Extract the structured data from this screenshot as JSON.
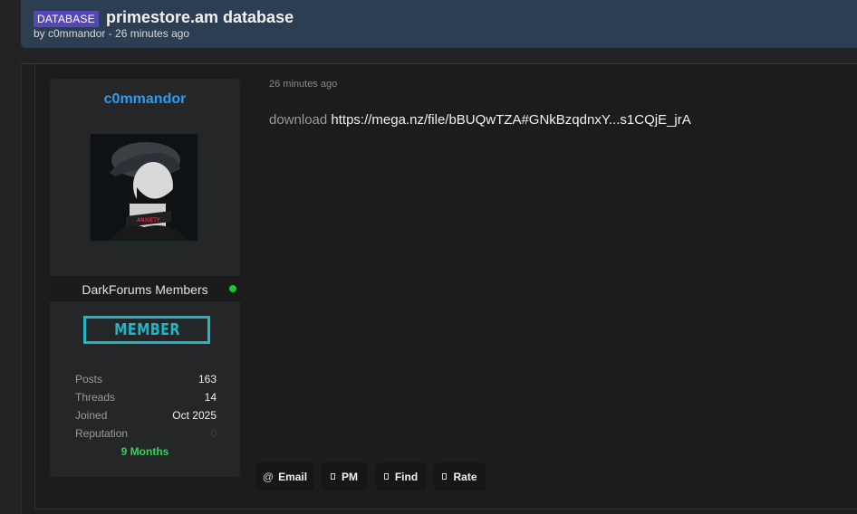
{
  "thread": {
    "prefix": "DATABASE",
    "title": "primestore.am database",
    "byline": "by c0mmandor - 26 minutes ago"
  },
  "user": {
    "name": "c0mmandor",
    "group": "DarkForums Members",
    "rank_badge": "MEMBER",
    "status_color": "#1fc52d",
    "stats": [
      {
        "label": "Posts",
        "value": "163"
      },
      {
        "label": "Threads",
        "value": "14"
      },
      {
        "label": "Joined",
        "value": "Oct 2025"
      },
      {
        "label": "Reputation",
        "value": "0"
      }
    ],
    "tenure": "9 Months"
  },
  "post": {
    "date": "26 minutes ago",
    "prefix_text": "download",
    "link_text": "https://mega.nz/file/bBUQwTZA#GNkBzqdnxY...s1CQjE_jrA"
  },
  "actions": [
    {
      "icon": "@",
      "label": "Email",
      "name": "email-button"
    },
    {
      "icon": "",
      "label": "PM",
      "name": "pm-button"
    },
    {
      "icon": "",
      "label": "Find",
      "name": "find-button"
    },
    {
      "icon": "",
      "label": "Rate",
      "name": "rate-button"
    }
  ]
}
